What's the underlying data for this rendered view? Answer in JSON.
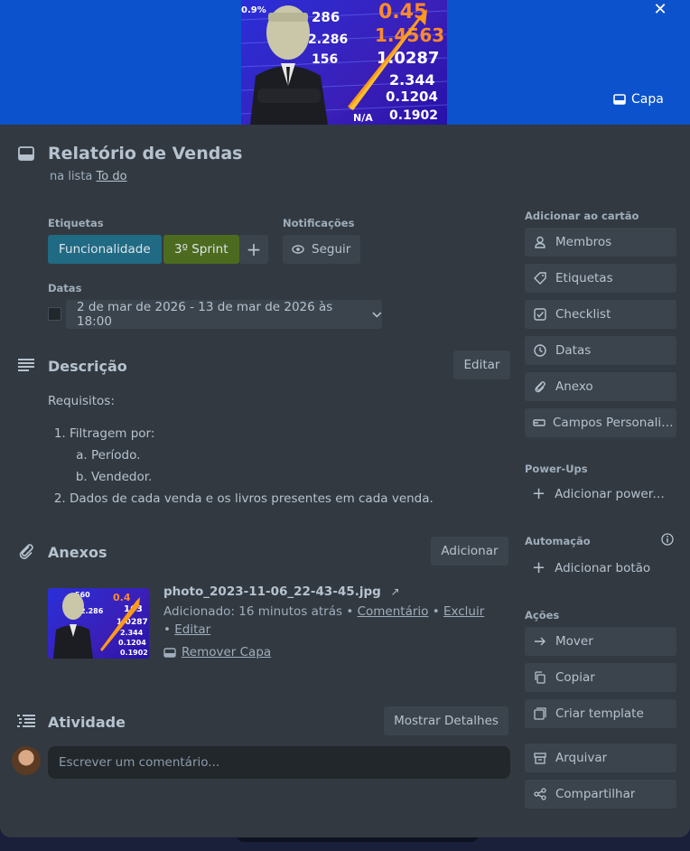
{
  "cover": {
    "button_label": "Capa",
    "close_icon": "close-icon",
    "image_numbers": [
      "0.9%",
      "286",
      "2.286",
      "156",
      "1.0287",
      "2.344",
      "0.1204",
      "0.1902",
      "N/A",
      "1.4563",
      "0.45"
    ]
  },
  "card": {
    "title": "Relatório de Vendas",
    "in_list_prefix": "na lista",
    "list_name": "To do"
  },
  "labels_section": {
    "heading": "Etiquetas",
    "labels": [
      {
        "text": "Funcionalidade",
        "color": "#206a83"
      },
      {
        "text": "3º Sprint",
        "color": "#4c6b1f"
      }
    ],
    "add_icon": "plus-icon"
  },
  "notifications": {
    "heading": "Notificações",
    "follow_label": "Seguir"
  },
  "dates": {
    "heading": "Datas",
    "value": "2 de mar de 2026 - 13 de mar de 2026 às 18:00"
  },
  "description": {
    "heading": "Descrição",
    "edit_label": "Editar",
    "intro": "Requisitos:",
    "item1": "Filtragem por:",
    "sub_a": "Período.",
    "sub_b": "Vendedor.",
    "item2": "Dados de cada venda e os livros presentes em cada venda."
  },
  "attachments": {
    "heading": "Anexos",
    "add_label": "Adicionar",
    "file_name": "photo_2023-11-06_22-43-45.jpg",
    "added_text": "Adicionado: 16 minutos atrás",
    "comment_link": "Comentário",
    "delete_link": "Excluir",
    "edit_link": "Editar",
    "remove_cover": "Remover Capa",
    "thumb_numbers": [
      "560",
      "0.4",
      "163",
      "2.286",
      "1.0287",
      "2.344",
      "0.1204",
      "0.1902"
    ]
  },
  "activity": {
    "heading": "Atividade",
    "details_label": "Mostrar Detalhes",
    "comment_placeholder": "Escrever um comentário..."
  },
  "sidebar": {
    "add_heading": "Adicionar ao cartão",
    "add_items": [
      {
        "label": "Membros",
        "icon": "person-icon"
      },
      {
        "label": "Etiquetas",
        "icon": "tag-icon"
      },
      {
        "label": "Checklist",
        "icon": "checkbox-icon"
      },
      {
        "label": "Datas",
        "icon": "clock-icon"
      },
      {
        "label": "Anexo",
        "icon": "paperclip-icon"
      },
      {
        "label": "Campos Personalizados",
        "icon": "fields-icon"
      }
    ],
    "powerups_heading": "Power-Ups",
    "powerups_add": "Adicionar power-ups",
    "automation_heading": "Automação",
    "automation_add": "Adicionar botão",
    "actions_heading": "Ações",
    "action_items": [
      {
        "label": "Mover",
        "icon": "arrow-right-icon"
      },
      {
        "label": "Copiar",
        "icon": "copy-icon"
      },
      {
        "label": "Criar template",
        "icon": "template-icon"
      },
      {
        "label": "Arquivar",
        "icon": "archive-icon"
      },
      {
        "label": "Compartilhar",
        "icon": "share-icon"
      }
    ]
  }
}
